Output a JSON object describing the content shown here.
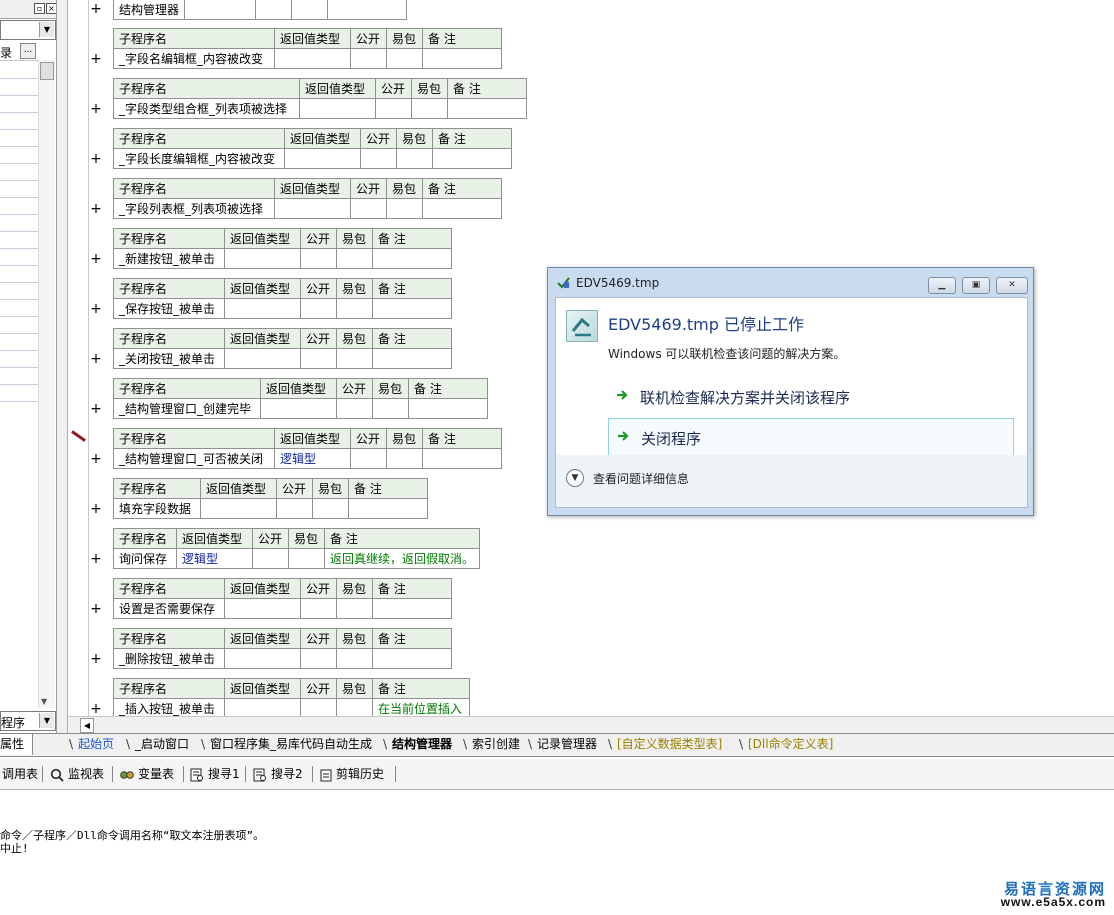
{
  "left_panel": {
    "row_label": "录",
    "row_button": "...",
    "bottom_combo": "程序",
    "bottom_tab": "属性"
  },
  "header": {
    "name": "子程序名",
    "return_type": "返回值类型",
    "public": "公开",
    "easy_pack": "易包",
    "note": "备 注"
  },
  "top_partial_row": "结构管理器",
  "subroutines": [
    {
      "name": "_字段名编辑框_内容被改变",
      "return_type": "",
      "note": ""
    },
    {
      "name": "_字段类型组合框_列表项被选择",
      "return_type": "",
      "note": ""
    },
    {
      "name": "_字段长度编辑框_内容被改变",
      "return_type": "",
      "note": ""
    },
    {
      "name": "_字段列表框_列表项被选择",
      "return_type": "",
      "note": ""
    },
    {
      "name": "_新建按钮_被单击",
      "return_type": "",
      "note": ""
    },
    {
      "name": "_保存按钮_被单击",
      "return_type": "",
      "note": ""
    },
    {
      "name": "_关闭按钮_被单击",
      "return_type": "",
      "note": ""
    },
    {
      "name": "_结构管理窗口_创建完毕",
      "return_type": "",
      "note": ""
    },
    {
      "name": "_结构管理窗口_可否被关闭",
      "return_type": "逻辑型",
      "note": ""
    },
    {
      "name": "填充字段数据",
      "return_type": "",
      "note": ""
    },
    {
      "name": "询问保存",
      "return_type": "逻辑型",
      "note": "返回真继续，返回假取消。"
    },
    {
      "name": "设置是否需要保存",
      "return_type": "",
      "note": ""
    },
    {
      "name": "_删除按钮_被单击",
      "return_type": "",
      "note": ""
    },
    {
      "name": "_插入按钮_被单击",
      "return_type": "",
      "note": "在当前位置插入"
    }
  ],
  "tabs": [
    {
      "label": "起始页",
      "style": "blue"
    },
    {
      "label": "_启动窗口",
      "style": ""
    },
    {
      "label": "窗口程序集_易库代码自动生成",
      "style": ""
    },
    {
      "label": "结构管理器",
      "style": "bold"
    },
    {
      "label": "索引创建",
      "style": ""
    },
    {
      "label": "记录管理器",
      "style": ""
    },
    {
      "label": "[自定义数据类型表]",
      "style": "olive"
    },
    {
      "label": "[Dll命令定义表]",
      "style": "olive"
    }
  ],
  "toolbar": {
    "call_table": "调用表",
    "watch_table": "监视表",
    "var_table": "变量表",
    "search1": "搜寻1",
    "search2": "搜寻2",
    "clip_history": "剪辑历史"
  },
  "output": {
    "line1": "命令／子程序／Dll命令调用名称“取文本注册表项”。",
    "line2": "中止!"
  },
  "watermark": {
    "cn": "易语言资源网",
    "url": "www.e5a5x.com"
  },
  "dialog": {
    "title": "EDV5469.tmp",
    "heading": "EDV5469.tmp 已停止工作",
    "subtitle": "Windows 可以联机检查该问题的解决方案。",
    "option_check": "联机检查解决方案并关闭该程序",
    "option_close": "关闭程序",
    "details": "查看问题详细信息"
  }
}
